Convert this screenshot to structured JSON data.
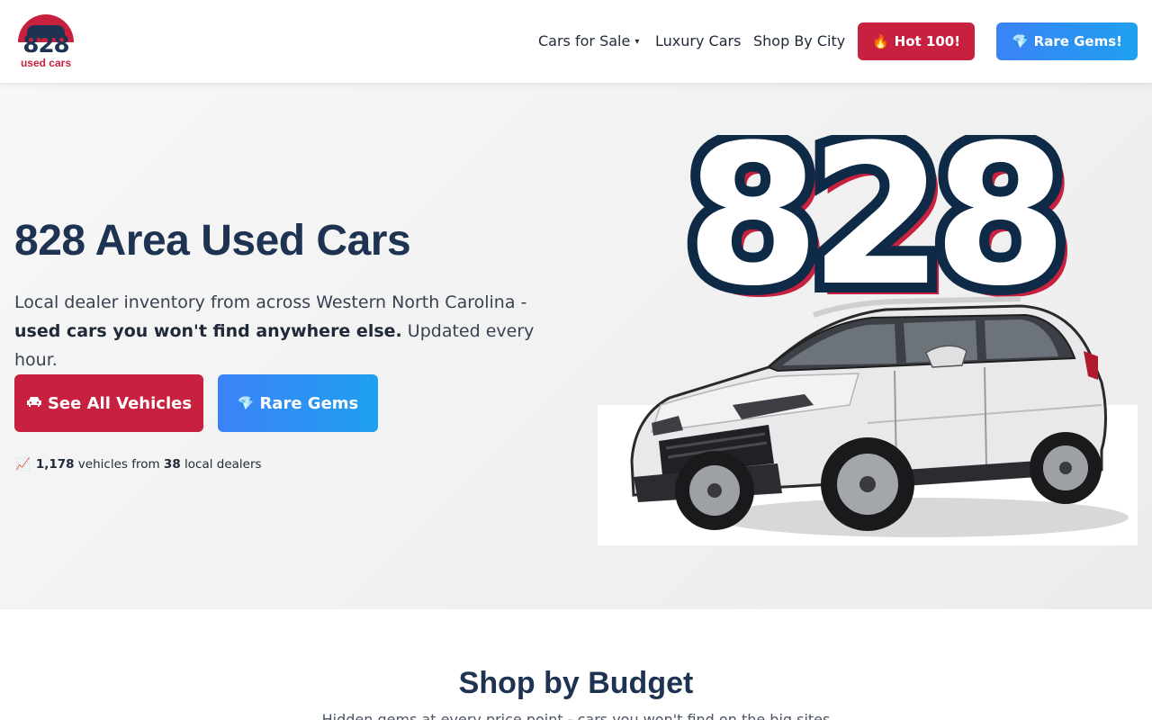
{
  "brand": {
    "logo_number": "828",
    "logo_subtitle": "used cars",
    "colors": {
      "navy": "#1e3352",
      "red": "#c8203f",
      "blue": "#3b82f6"
    }
  },
  "nav": {
    "cars_for_sale": "Cars for Sale",
    "cars_for_sale_caret": "chevron-down-icon",
    "luxury_cars": "Luxury Cars",
    "shop_by_city": "Shop By City",
    "hot_100": {
      "icon": "🔥",
      "label": "Hot 100!"
    },
    "rare_gems": {
      "icon": "💎",
      "label": "Rare Gems!"
    }
  },
  "hero": {
    "title": "828 Area Used Cars",
    "description_prefix": "Local dealer inventory from across Western North Carolina - ",
    "description_bold": "used cars you won't find anywhere else.",
    "description_suffix": " Updated every hour.",
    "primary_button": {
      "icon": "car-icon",
      "label": "See All Vehicles"
    },
    "secondary_button": {
      "icon": "💎",
      "label": "Rare Gems"
    },
    "stats": {
      "icon": "📈",
      "vehicle_count": "1,178",
      "vehicles_text": " vehicles from ",
      "dealer_count": "38",
      "dealers_text": " local dealers"
    },
    "art_number": "828"
  },
  "budget": {
    "title": "Shop by Budget",
    "subtitle": "Hidden gems at every price point - cars you won't find on the big sites"
  }
}
